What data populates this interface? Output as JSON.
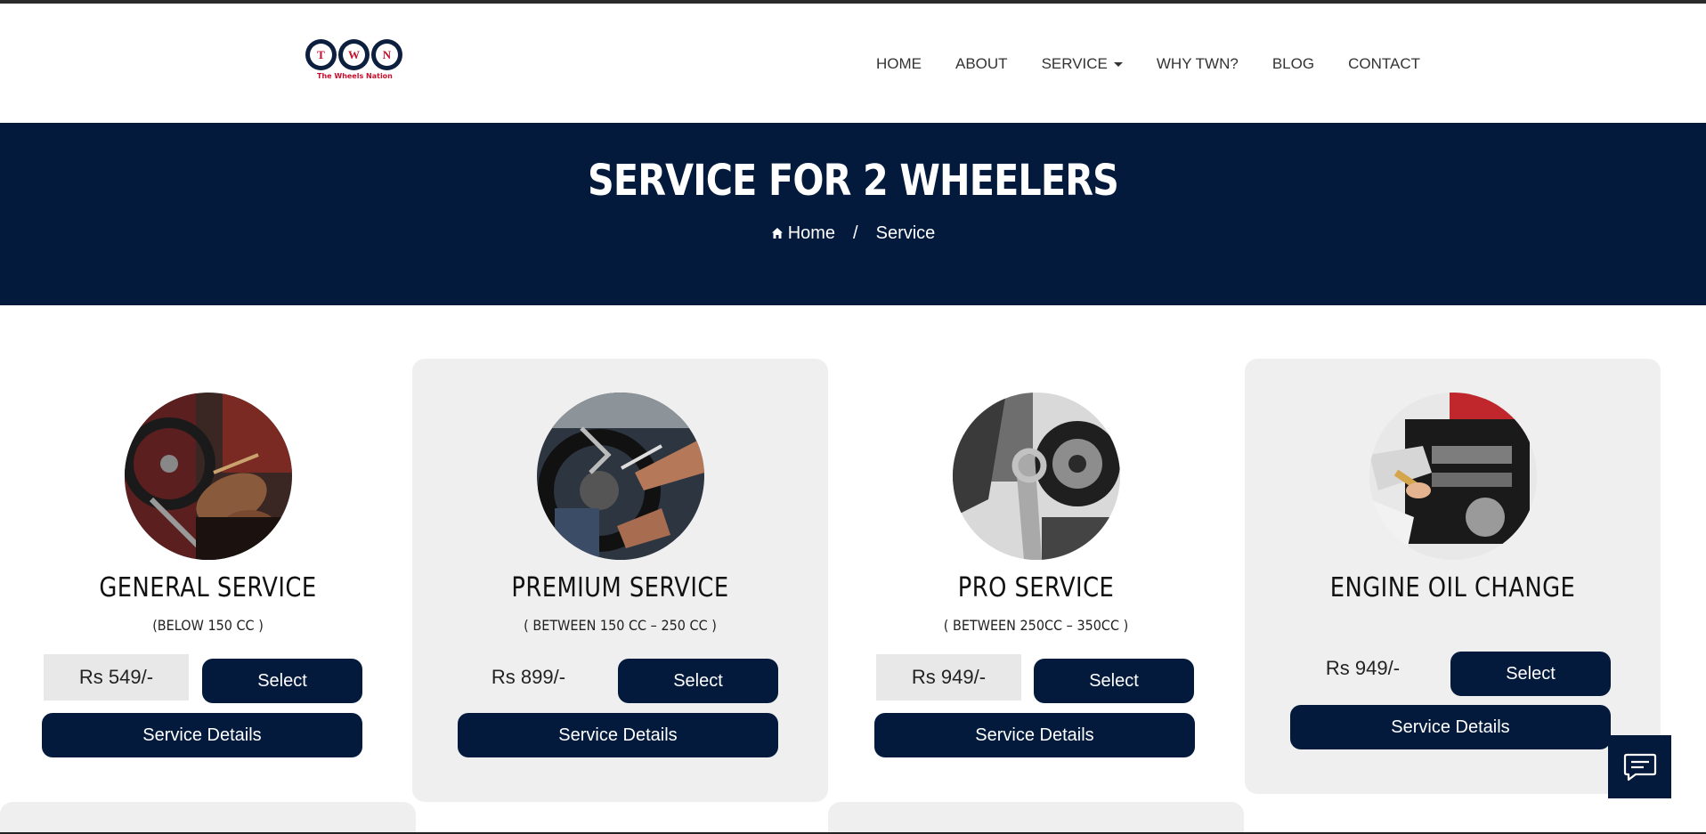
{
  "brand": {
    "logo_letters": [
      "T",
      "W",
      "N"
    ],
    "tagline": "The Wheels Nation",
    "primary_color": "#031a3c",
    "accent_color": "#c8102e"
  },
  "nav": {
    "items": [
      {
        "label": "HOME"
      },
      {
        "label": "ABOUT"
      },
      {
        "label": "SERVICE",
        "dropdown": true
      },
      {
        "label": "WHY TWN?"
      },
      {
        "label": "BLOG"
      },
      {
        "label": "CONTACT"
      }
    ]
  },
  "banner": {
    "title": "SERVICE FOR 2 WHEELERS",
    "breadcrumb": {
      "home": "Home",
      "separator": "/",
      "current": "Service"
    }
  },
  "services": [
    {
      "title": "GENERAL SERVICE",
      "subtitle": "(BELOW 150 CC )",
      "price": "Rs 549/-",
      "select_label": "Select",
      "details_label": "Service Details",
      "image": "bike chain maintenance photo"
    },
    {
      "title": "PREMIUM SERVICE",
      "subtitle": "( BETWEEN 150 CC – 250 CC )",
      "price": "Rs 899/-",
      "select_label": "Select",
      "details_label": "Service Details",
      "image": "mechanic wrench photo"
    },
    {
      "title": "PRO SERVICE",
      "subtitle": "( BETWEEN 250CC – 350CC )",
      "price": "Rs 949/-",
      "select_label": "Select",
      "details_label": "Service Details",
      "image": "motorcycle engine spanner photo"
    },
    {
      "title": "ENGINE OIL CHANGE",
      "subtitle": "",
      "price": "Rs 949/-",
      "select_label": "Select",
      "details_label": "Service Details",
      "image": "engine oil pour photo"
    }
  ],
  "chat": {
    "icon": "chat-icon"
  }
}
